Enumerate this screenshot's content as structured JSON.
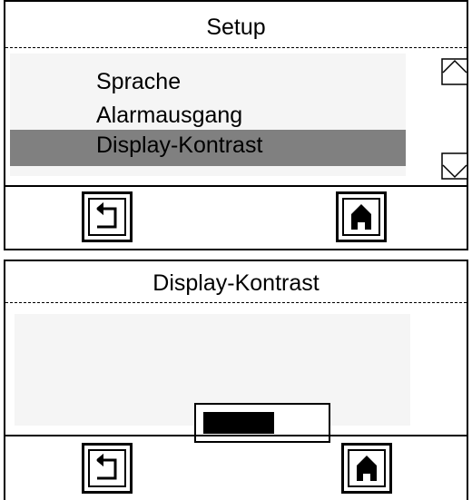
{
  "setup_screen": {
    "title": "Setup",
    "menu_items": [
      {
        "label": "Sprache",
        "selected": false
      },
      {
        "label": "Alarmausgang",
        "selected": false
      },
      {
        "label": "Display-Kontrast",
        "selected": true
      }
    ],
    "icons": {
      "scroll_up": "chevron-up-icon",
      "scroll_down": "chevron-down-icon",
      "back": "back-arrow-icon",
      "home": "home-icon"
    }
  },
  "contrast_screen": {
    "title": "Display-Kontrast",
    "contrast_level": 0.6,
    "icons": {
      "back": "back-arrow-icon",
      "home": "home-icon"
    }
  },
  "colors": {
    "selection": "#808080",
    "panel": "#f5f5f5"
  }
}
